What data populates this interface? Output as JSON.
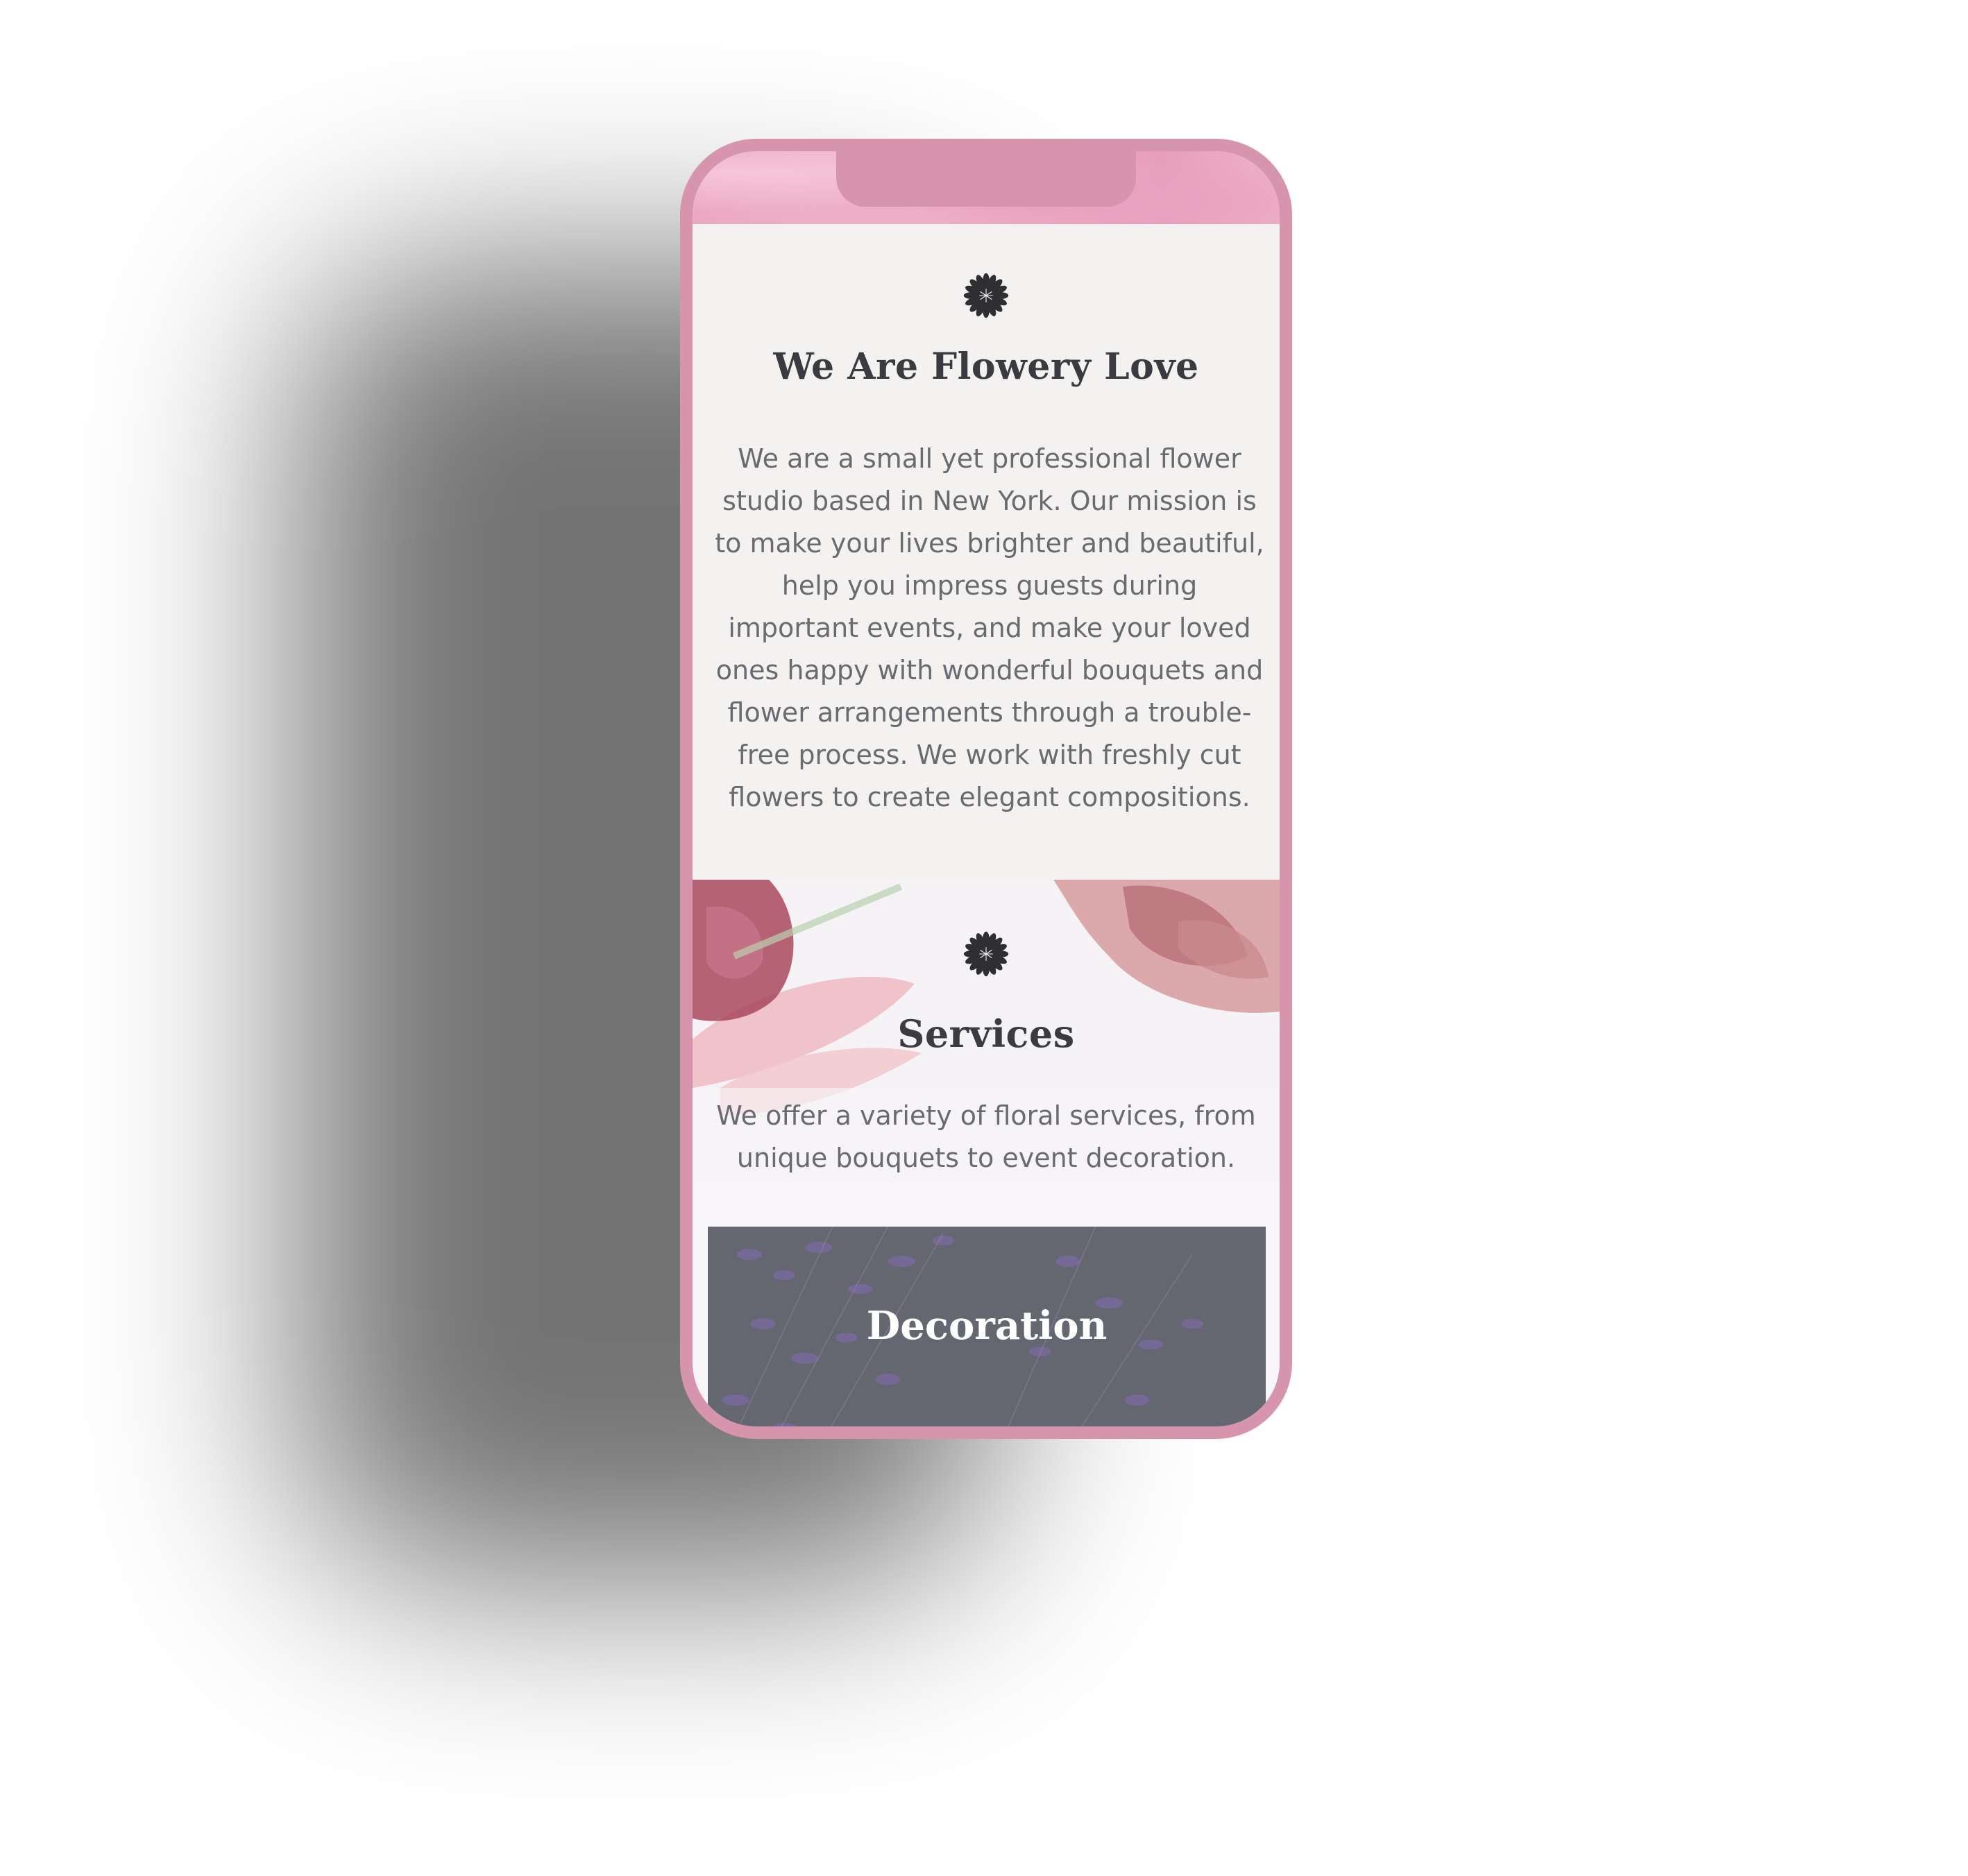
{
  "about": {
    "title": "We Are Flowery Love",
    "text": "We are a small yet professional flower studio based in New York. Our mission is to make your lives brighter and beautiful, help you impress guests during important events, and make your loved ones happy with wonderful bouquets and flower arrangements through a trouble-free process. We work with freshly cut flowers to create elegant compositions.",
    "icon": "flower-icon"
  },
  "services": {
    "title": "Services",
    "text": "We offer a variety of floral services, from unique bouquets to event decoration.",
    "icon": "flower-icon"
  },
  "cards": [
    {
      "title": "Decoration"
    }
  ],
  "colors": {
    "phone_frame": "#d695ad",
    "heading": "#3a3b40",
    "body_text": "#6b6a70",
    "screen_bg": "#f4f2f1",
    "card_bg": "#62646e"
  }
}
